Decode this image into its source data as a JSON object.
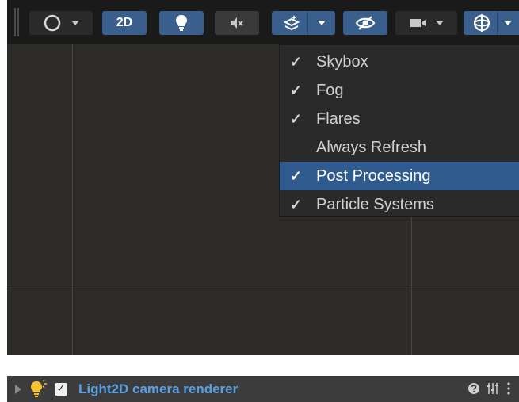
{
  "toolbar": {
    "mode_2d_label": "2D"
  },
  "scene_visibility_menu": {
    "items": [
      {
        "label": "Skybox",
        "checked": true,
        "selected": false
      },
      {
        "label": "Fog",
        "checked": true,
        "selected": false
      },
      {
        "label": "Flares",
        "checked": true,
        "selected": false
      },
      {
        "label": "Always Refresh",
        "checked": false,
        "selected": false
      },
      {
        "label": "Post Processing",
        "checked": true,
        "selected": true
      },
      {
        "label": "Particle Systems",
        "checked": true,
        "selected": false
      }
    ],
    "check_glyph": "✓"
  },
  "component": {
    "title": "Light2D camera renderer",
    "enabled_glyph": "✓",
    "icons": [
      "expand-arrow-icon",
      "light-bulb-icon",
      "help-icon",
      "preset-sliders-icon",
      "more-options-icon"
    ]
  },
  "colors": {
    "toolbar_bg": "#1a1a1a",
    "scene_bg": "#2c2b28",
    "accent_blue": "#3a5f8c",
    "menu_selected": "#2f5b8e",
    "component_title": "#5aa0e6"
  }
}
